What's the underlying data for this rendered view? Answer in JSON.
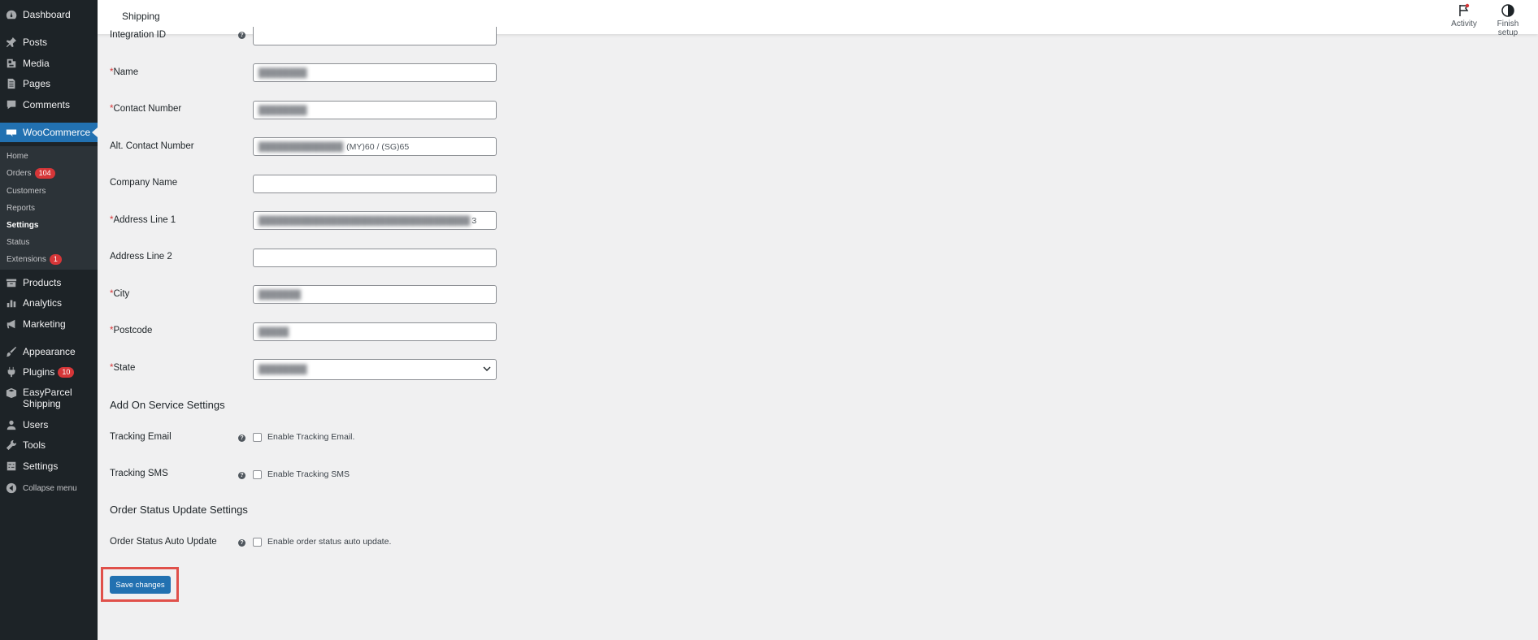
{
  "sidebar": {
    "items": [
      {
        "label": "Dashboard",
        "icon": "dashboard-icon"
      },
      {
        "label": "Posts",
        "icon": "pin-icon"
      },
      {
        "label": "Media",
        "icon": "media-icon"
      },
      {
        "label": "Pages",
        "icon": "pages-icon"
      },
      {
        "label": "Comments",
        "icon": "comment-icon"
      },
      {
        "label": "WooCommerce",
        "icon": "woo-icon"
      },
      {
        "label": "Products",
        "icon": "archive-icon"
      },
      {
        "label": "Analytics",
        "icon": "chart-icon"
      },
      {
        "label": "Marketing",
        "icon": "megaphone-icon"
      },
      {
        "label": "Appearance",
        "icon": "brush-icon"
      },
      {
        "label": "Plugins",
        "icon": "plug-icon",
        "badge": "10"
      },
      {
        "label": "EasyParcel\nShipping",
        "icon": "parcel-icon"
      },
      {
        "label": "Users",
        "icon": "user-icon"
      },
      {
        "label": "Tools",
        "icon": "wrench-icon"
      },
      {
        "label": "Settings",
        "icon": "sliders-icon"
      },
      {
        "label": "Collapse menu",
        "icon": "collapse-icon"
      }
    ],
    "woo_submenu": [
      {
        "label": "Home"
      },
      {
        "label": "Orders",
        "badge": "104"
      },
      {
        "label": "Customers"
      },
      {
        "label": "Reports"
      },
      {
        "label": "Settings"
      },
      {
        "label": "Status"
      },
      {
        "label": "Extensions",
        "badge": "1"
      }
    ]
  },
  "topbar": {
    "title": "Shipping",
    "activity_label": "Activity",
    "finish_setup_label": "Finish setup"
  },
  "form": {
    "integration_id_label": "Integration ID",
    "fields": [
      {
        "label": "Name",
        "required": true,
        "value": "████████"
      },
      {
        "label": "Contact Number",
        "required": true,
        "value": "████████"
      },
      {
        "label": "Alt. Contact Number",
        "required": false,
        "value": "(MY)60 / (SG)65"
      },
      {
        "label": "Company Name",
        "required": false,
        "value": ""
      },
      {
        "label": "Address Line 1",
        "required": true,
        "value": "3"
      },
      {
        "label": "Address Line 2",
        "required": false,
        "value": ""
      },
      {
        "label": "City",
        "required": true,
        "value": "███████"
      },
      {
        "label": "Postcode",
        "required": true,
        "value": "█████"
      },
      {
        "label": "State",
        "required": true,
        "value": "████████"
      }
    ],
    "addon_section_title": "Add On Service Settings",
    "tracking_email_label": "Tracking Email",
    "tracking_email_checkbox": "Enable Tracking Email.",
    "tracking_sms_label": "Tracking SMS",
    "tracking_sms_checkbox": "Enable Tracking SMS",
    "order_section_title": "Order Status Update Settings",
    "order_auto_label": "Order Status Auto Update",
    "order_auto_checkbox": "Enable order status auto update.",
    "required_mark": "*",
    "save_label": "Save changes"
  },
  "colors": {
    "sidebar_bg": "#1d2327",
    "accent": "#2271b1",
    "badge": "#d63638",
    "highlight": "#e0504a"
  }
}
